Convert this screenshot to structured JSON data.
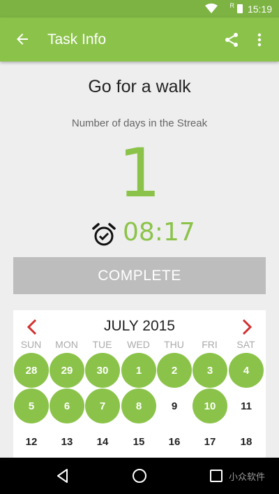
{
  "status_bar": {
    "time": "15:19",
    "signal_label": "R"
  },
  "app_bar": {
    "title": "Task Info"
  },
  "task": {
    "name": "Go for a walk",
    "streak_label": "Number of days in the Streak",
    "streak_count": "1",
    "alarm_time": "08:17"
  },
  "complete_button": {
    "label": "COMPLETE"
  },
  "calendar": {
    "month": "JULY 2015",
    "weekdays": [
      "SUN",
      "MON",
      "TUE",
      "WED",
      "THU",
      "FRI",
      "SAT"
    ],
    "rows": [
      [
        {
          "d": "28",
          "done": true
        },
        {
          "d": "29",
          "done": true
        },
        {
          "d": "30",
          "done": true
        },
        {
          "d": "1",
          "done": true
        },
        {
          "d": "2",
          "done": true
        },
        {
          "d": "3",
          "done": true
        },
        {
          "d": "4",
          "done": true
        }
      ],
      [
        {
          "d": "5",
          "done": true
        },
        {
          "d": "6",
          "done": true
        },
        {
          "d": "7",
          "done": true
        },
        {
          "d": "8",
          "done": true
        },
        {
          "d": "9",
          "done": false
        },
        {
          "d": "10",
          "done": true
        },
        {
          "d": "11",
          "done": false
        }
      ],
      [
        {
          "d": "12",
          "done": false
        },
        {
          "d": "13",
          "done": false
        },
        {
          "d": "14",
          "done": false
        },
        {
          "d": "15",
          "done": false
        },
        {
          "d": "16",
          "done": false
        },
        {
          "d": "17",
          "done": false
        },
        {
          "d": "18",
          "done": false
        }
      ]
    ]
  },
  "watermark": "小众软件",
  "colors": {
    "primary": "#8bc34a",
    "primary_dark": "#7cb342",
    "nav_arrow": "#d32f2f",
    "button_disabled": "#bdbdbd"
  },
  "icons": [
    "back-arrow-icon",
    "share-icon",
    "more-vert-icon",
    "alarm-clock-icon",
    "chevron-left-icon",
    "chevron-right-icon",
    "nav-back-icon",
    "nav-home-icon",
    "nav-recent-icon"
  ]
}
